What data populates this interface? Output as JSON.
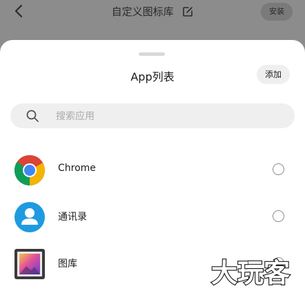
{
  "topbar": {
    "title": "自定义图标库",
    "install_label": "安装",
    "back_icon": "chevron-left-icon",
    "edit_icon": "edit-icon"
  },
  "sheet": {
    "title": "App列表",
    "add_label": "添加",
    "search": {
      "placeholder": "搜索应用",
      "value": ""
    },
    "apps": [
      {
        "name": "Chrome",
        "icon": "chrome-icon",
        "selected": false
      },
      {
        "name": "通讯录",
        "icon": "contacts-icon",
        "selected": false
      },
      {
        "name": "图库",
        "icon": "gallery-icon",
        "selected": false
      }
    ]
  },
  "watermark": {
    "text": "大玩客"
  },
  "colors": {
    "overlay": "#8c8c8c",
    "sheet": "#ffffff",
    "search_bg": "#efefef",
    "contacts_blue": "#1e9be0"
  }
}
